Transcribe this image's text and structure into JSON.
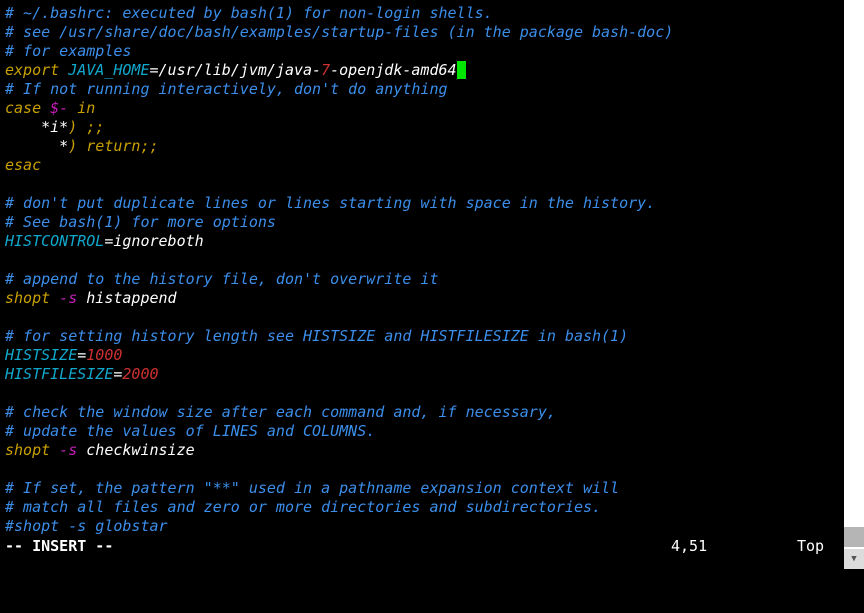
{
  "editor": {
    "lines": [
      [
        {
          "t": "# ~/.bashrc: executed by bash(1) for non-login shells.",
          "c": "comment"
        }
      ],
      [
        {
          "t": "# see /usr/share/doc/bash/examples/startup-files (in the package bash-doc)",
          "c": "comment"
        }
      ],
      [
        {
          "t": "# for examples",
          "c": "comment"
        }
      ],
      [
        {
          "t": "export",
          "c": "keyword"
        },
        {
          "t": " JAVA_HOME",
          "c": "var"
        },
        {
          "t": "=/usr/lib/jvm/java-",
          "c": "text"
        },
        {
          "t": "7",
          "c": "number"
        },
        {
          "t": "-openjdk-amd64",
          "c": "text"
        },
        {
          "t": " ",
          "c": "cursor"
        }
      ],
      [
        {
          "t": "# If not running interactively, don't do anything",
          "c": "comment"
        }
      ],
      [
        {
          "t": "case",
          "c": "keyword"
        },
        {
          "t": " ",
          "c": "text"
        },
        {
          "t": "$-",
          "c": "special"
        },
        {
          "t": " in",
          "c": "keyword"
        }
      ],
      [
        {
          "t": "    *i*",
          "c": "text"
        },
        {
          "t": ") ;;",
          "c": "keyword"
        }
      ],
      [
        {
          "t": "      *",
          "c": "text"
        },
        {
          "t": ") return;;",
          "c": "keyword"
        }
      ],
      [
        {
          "t": "esac",
          "c": "keyword"
        }
      ],
      [],
      [
        {
          "t": "# don't put duplicate lines or lines starting with space in the history.",
          "c": "comment"
        }
      ],
      [
        {
          "t": "# See bash(1) for more options",
          "c": "comment"
        }
      ],
      [
        {
          "t": "HISTCONTROL",
          "c": "var"
        },
        {
          "t": "=ignoreboth",
          "c": "text"
        }
      ],
      [],
      [
        {
          "t": "# append to the history file, don't overwrite it",
          "c": "comment"
        }
      ],
      [
        {
          "t": "shopt",
          "c": "keyword"
        },
        {
          "t": " -s",
          "c": "special"
        },
        {
          "t": " histappend",
          "c": "text"
        }
      ],
      [],
      [
        {
          "t": "# for setting history length see HISTSIZE and HISTFILESIZE in bash(1)",
          "c": "comment"
        }
      ],
      [
        {
          "t": "HISTSIZE",
          "c": "var"
        },
        {
          "t": "=",
          "c": "text"
        },
        {
          "t": "1000",
          "c": "number"
        }
      ],
      [
        {
          "t": "HISTFILESIZE",
          "c": "var"
        },
        {
          "t": "=",
          "c": "text"
        },
        {
          "t": "2000",
          "c": "number"
        }
      ],
      [],
      [
        {
          "t": "# check the window size after each command and, if necessary,",
          "c": "comment"
        }
      ],
      [
        {
          "t": "# update the values of LINES and COLUMNS.",
          "c": "comment"
        }
      ],
      [
        {
          "t": "shopt",
          "c": "keyword"
        },
        {
          "t": " -s",
          "c": "special"
        },
        {
          "t": " checkwinsize",
          "c": "text"
        }
      ],
      [],
      [
        {
          "t": "# If set, the pattern \"**\" used in a pathname expansion context will",
          "c": "comment"
        }
      ],
      [
        {
          "t": "# match all files and zero or more directories and subdirectories.",
          "c": "comment"
        }
      ],
      [
        {
          "t": "#shopt -s globstar",
          "c": "comment"
        }
      ]
    ]
  },
  "status": {
    "mode": "-- INSERT --",
    "position": "4,51",
    "scroll": "Top"
  },
  "colors": {
    "comment": "#3b8eea",
    "keyword": "#c8a000",
    "variable": "#11a8cd",
    "number": "#cd3131",
    "special": "#c21fb7",
    "cursor": "#00e600"
  }
}
